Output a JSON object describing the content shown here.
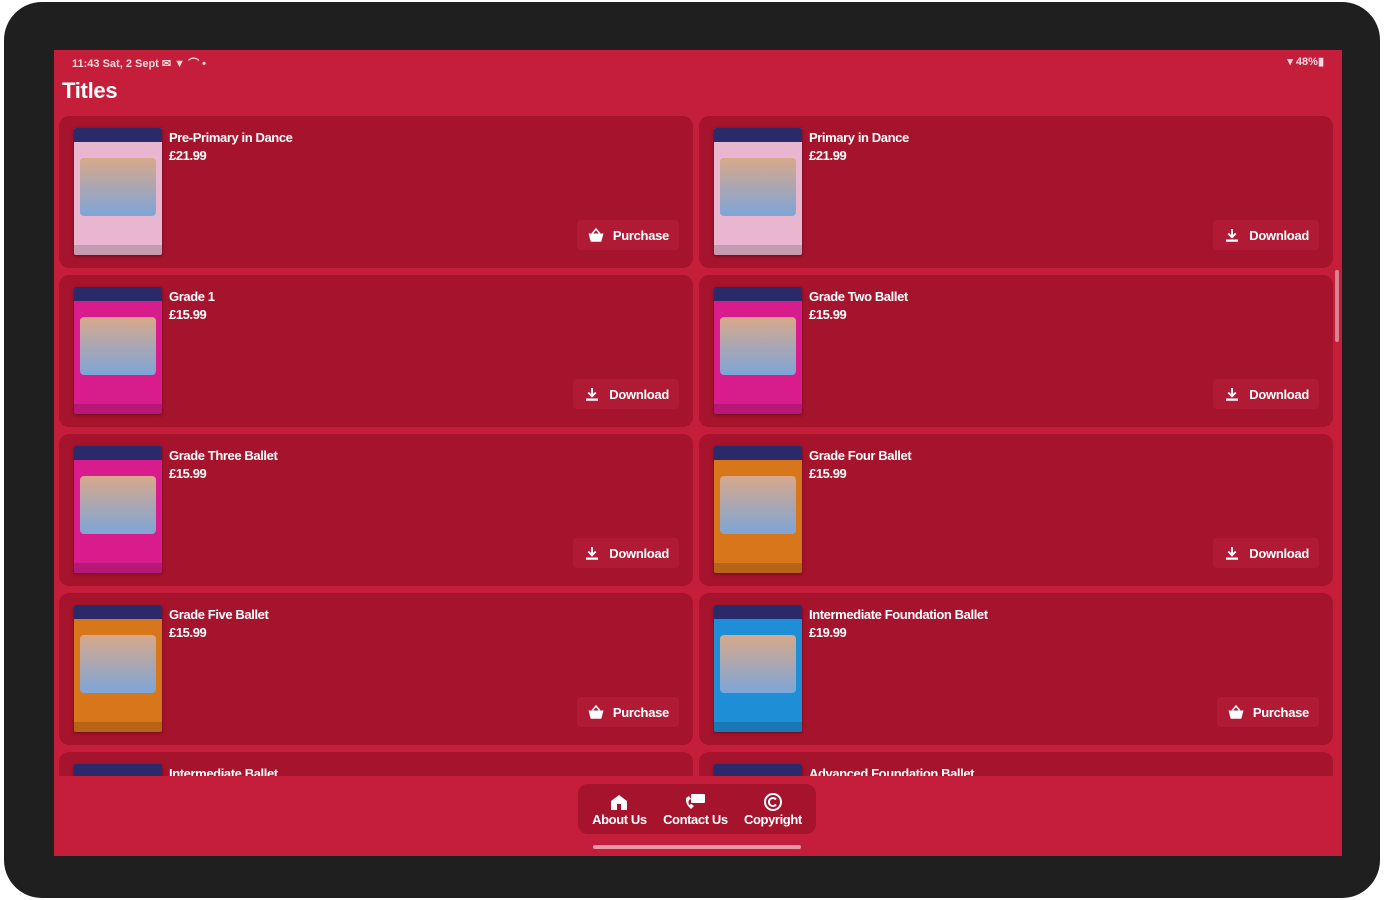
{
  "status_bar": {
    "left": "11:43  Sat, 2 Sept  ✉ ▼ ⌒ •",
    "right": "▾ 48%▮"
  },
  "page_title": "Titles",
  "titles": [
    {
      "name": "Pre-Primary in Dance",
      "price": "£21.99",
      "action": "Purchase",
      "action_icon": "basket-icon",
      "cover_color": "#e8b7cf"
    },
    {
      "name": "Primary in Dance",
      "price": "£21.99",
      "action": "Download",
      "action_icon": "download-icon",
      "cover_color": "#e8b7cf"
    },
    {
      "name": "Grade 1",
      "price": "£15.99",
      "action": "Download",
      "action_icon": "download-icon",
      "cover_color": "#d81c8c"
    },
    {
      "name": "Grade Two Ballet",
      "price": "£15.99",
      "action": "Download",
      "action_icon": "download-icon",
      "cover_color": "#d81c8c"
    },
    {
      "name": "Grade Three Ballet",
      "price": "£15.99",
      "action": "Download",
      "action_icon": "download-icon",
      "cover_color": "#d81c8c"
    },
    {
      "name": "Grade Four Ballet",
      "price": "£15.99",
      "action": "Download",
      "action_icon": "download-icon",
      "cover_color": "#d8761c"
    },
    {
      "name": "Grade Five Ballet",
      "price": "£15.99",
      "action": "Purchase",
      "action_icon": "basket-icon",
      "cover_color": "#d8761c"
    },
    {
      "name": "Intermediate Foundation Ballet",
      "price": "£19.99",
      "action": "Purchase",
      "action_icon": "basket-icon",
      "cover_color": "#1e8fd6"
    },
    {
      "name": "Intermediate Ballet",
      "price": "",
      "action": "",
      "action_icon": "",
      "cover_color": "#1e4fa8"
    },
    {
      "name": "Advanced Foundation Ballet",
      "price": "",
      "action": "",
      "action_icon": "",
      "cover_color": "#888888"
    }
  ],
  "bottom_nav": {
    "about": "About Us",
    "contact": "Contact Us",
    "copyright": "Copyright"
  },
  "colors": {
    "background": "#c41e3a",
    "card": "#a6132d",
    "button": "#b01a35"
  }
}
